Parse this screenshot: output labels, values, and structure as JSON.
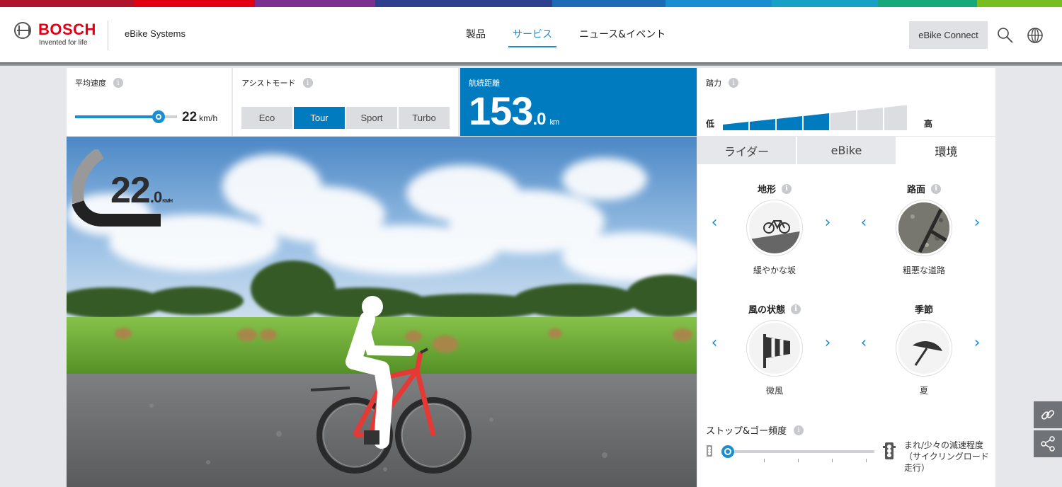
{
  "header": {
    "brand": "BOSCH",
    "tagline": "Invented for life",
    "product": "eBike Systems",
    "nav": [
      "製品",
      "サービス",
      "ニュース&イベント"
    ],
    "nav_active": 1,
    "connect_label": "eBike Connect"
  },
  "stats": {
    "avg_speed": {
      "label": "平均速度",
      "value": "22",
      "unit": "km/h",
      "slider_fraction": 0.82
    },
    "assist": {
      "label": "アシストモード",
      "modes": [
        "Eco",
        "Tour",
        "Sport",
        "Turbo"
      ],
      "active": "Tour"
    },
    "range": {
      "label": "航続距離",
      "value_int": "153",
      "value_dec": ".0",
      "unit": "km"
    },
    "effort": {
      "label": "踏力",
      "low": "低",
      "high": "高",
      "level": 4,
      "max_level": 7
    }
  },
  "scene": {
    "speed_int": "22",
    "speed_dec": ".0",
    "speed_unit": "KM/H"
  },
  "settings": {
    "tabs": [
      "ライダー",
      "eBike",
      "環境"
    ],
    "active_tab": 2,
    "terrain": {
      "label": "地形",
      "value": "緩やかな坂",
      "icon": "bike-hill-icon"
    },
    "surface": {
      "label": "路面",
      "value": "粗悪な道路",
      "icon": "rough-road-icon"
    },
    "wind": {
      "label": "風の状態",
      "value": "微風",
      "icon": "windsock-icon"
    },
    "season": {
      "label": "季節",
      "value": "夏",
      "icon": "umbrella-icon"
    },
    "stop_go": {
      "label": "ストップ&ゴー頻度",
      "caption": "まれ/少々の減速程度（サイクリングロード走行）",
      "level": 0
    }
  },
  "colors": {
    "accent": "#007bc0",
    "bosch_red": "#e20015"
  }
}
